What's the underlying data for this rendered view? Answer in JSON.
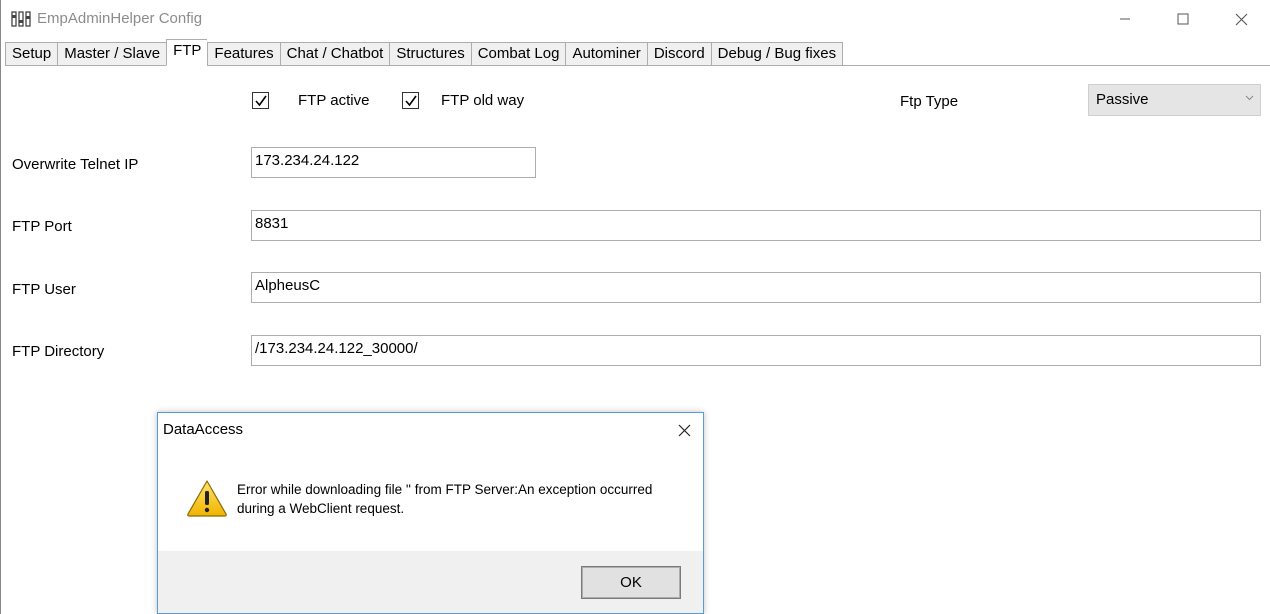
{
  "window": {
    "title": "EmpAdminHelper Config"
  },
  "tabs": [
    {
      "label": "Setup",
      "active": false
    },
    {
      "label": "Master / Slave",
      "active": false
    },
    {
      "label": "FTP",
      "active": true
    },
    {
      "label": "Features",
      "active": false
    },
    {
      "label": "Chat / Chatbot",
      "active": false
    },
    {
      "label": "Structures",
      "active": false
    },
    {
      "label": "Combat Log",
      "active": false
    },
    {
      "label": "Autominer",
      "active": false
    },
    {
      "label": "Discord",
      "active": false
    },
    {
      "label": "Debug / Bug fixes",
      "active": false
    }
  ],
  "ftp": {
    "ftp_active": {
      "label": "FTP active",
      "checked": true
    },
    "ftp_old_way": {
      "label": "FTP old way",
      "checked": true
    },
    "ftp_type_label": "Ftp Type",
    "ftp_type_value": "Passive",
    "telnet_ip": {
      "label": "Overwrite Telnet IP",
      "value": "173.234.24.122"
    },
    "port": {
      "label": "FTP Port",
      "value": "8831"
    },
    "user": {
      "label": "FTP User",
      "value": "AlpheusC"
    },
    "directory": {
      "label": "FTP Directory",
      "value": "/173.234.24.122_30000/"
    }
  },
  "dialog": {
    "title": "DataAccess",
    "message": "Error while downloading file '' from FTP Server:An exception occurred during a WebClient request.",
    "ok_label": "OK",
    "icon": "warning-icon"
  },
  "colors": {
    "dialog_border": "#5b9bd5",
    "warning_yellow": "#f5c518"
  }
}
